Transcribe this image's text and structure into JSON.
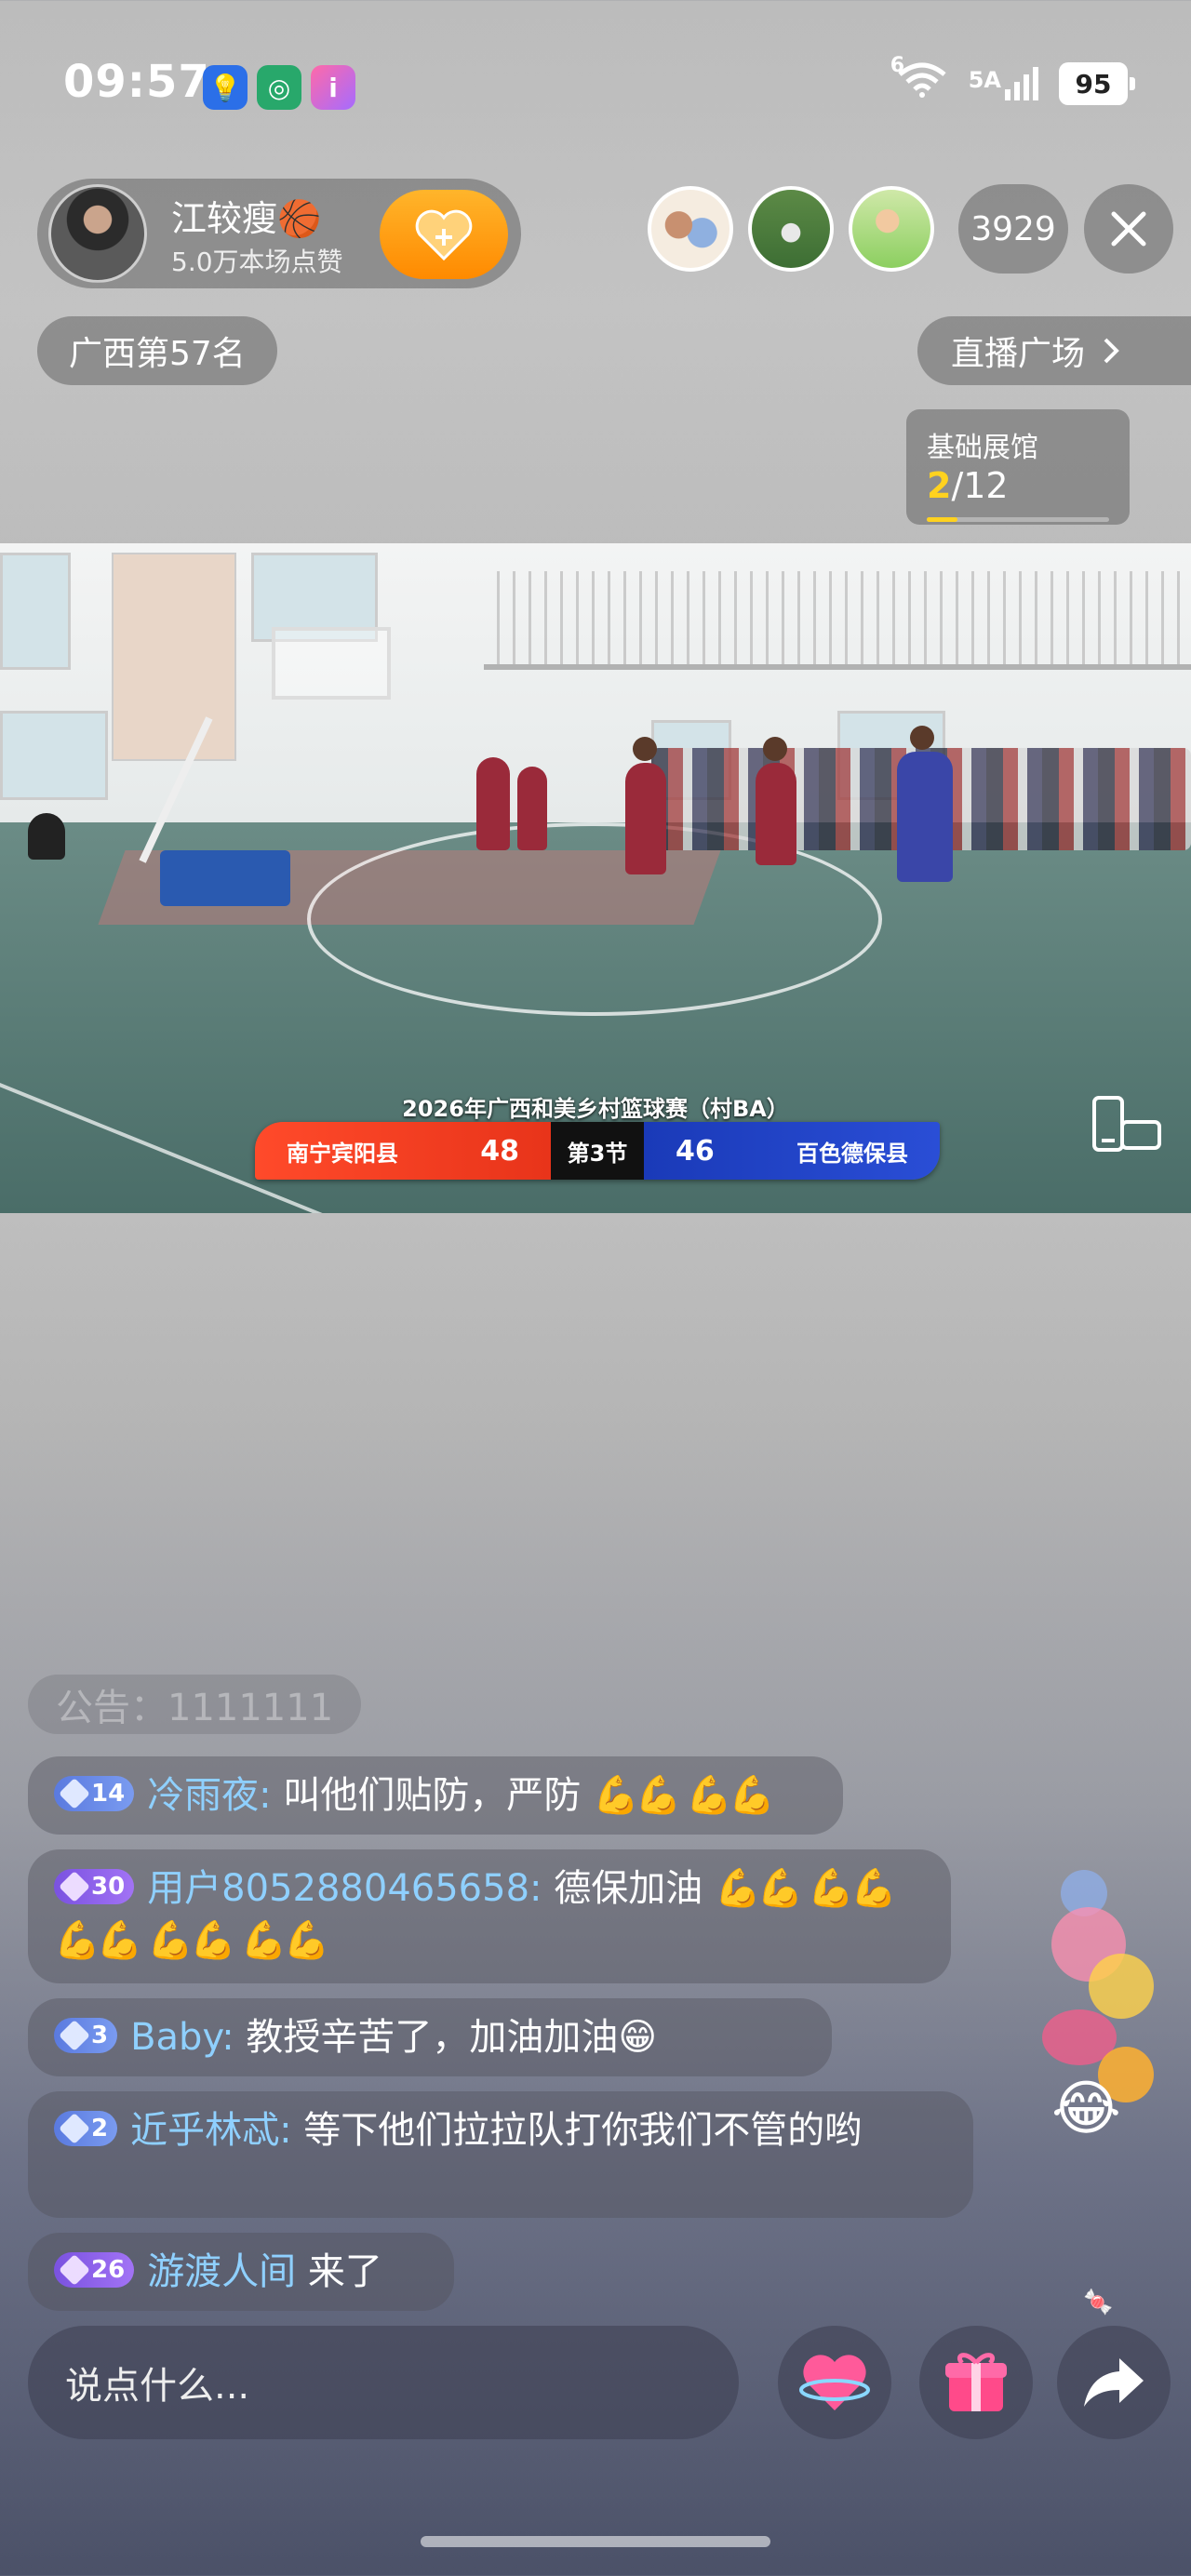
{
  "status_bar": {
    "time": "09:57",
    "network": "6",
    "signal": "5A",
    "battery": "95"
  },
  "host": {
    "name": "江较瘦🏀",
    "likes": "5.0万本场点赞"
  },
  "viewers": {
    "count": "3929"
  },
  "rank": {
    "label": "广西第57名"
  },
  "plaza": {
    "label": "直播广场"
  },
  "gallery": {
    "title": "基础展馆",
    "current": "2",
    "total": "/12",
    "progress_fraction": 0.17
  },
  "scoreboard": {
    "title": "2026年广西和美乡村篮球赛（村BA）",
    "home_team": "南宁宾阳县",
    "home_score": "48",
    "period": "第3节",
    "away_score": "46",
    "away_team": "百色德保县"
  },
  "chat": {
    "faded": "公告：1111111",
    "messages": [
      {
        "level": "14",
        "user": "冷雨夜:",
        "text": "叫他们贴防，严防",
        "emoji": "💪💪 💪💪"
      },
      {
        "level": "30",
        "user": "用户8052880465658:",
        "text": "德保加油",
        "emoji": "💪💪 💪💪 💪💪 💪💪 💪💪"
      },
      {
        "level": "3",
        "user": "Baby:",
        "text": "教授辛苦了，加油加油😁",
        "emoji": ""
      },
      {
        "level": "2",
        "user": "近乎林忒:",
        "text": "等下他们拉拉队打你我们不管的哟",
        "emoji": ""
      },
      {
        "level": "26",
        "user": "游渡人间",
        "text": "来了",
        "emoji": ""
      }
    ]
  },
  "input": {
    "placeholder": "说点什么..."
  },
  "icons": {
    "close": "close-icon",
    "chevron": "chevron-right-icon",
    "like": "heart-icon",
    "gift": "gift-icon",
    "share": "share-icon"
  },
  "colors": {
    "home_team": "#e8341a",
    "away_team": "#2a4ed6",
    "follow": "#ff9a10",
    "username": "#8fd0ff",
    "progress": "#ffd21f"
  }
}
